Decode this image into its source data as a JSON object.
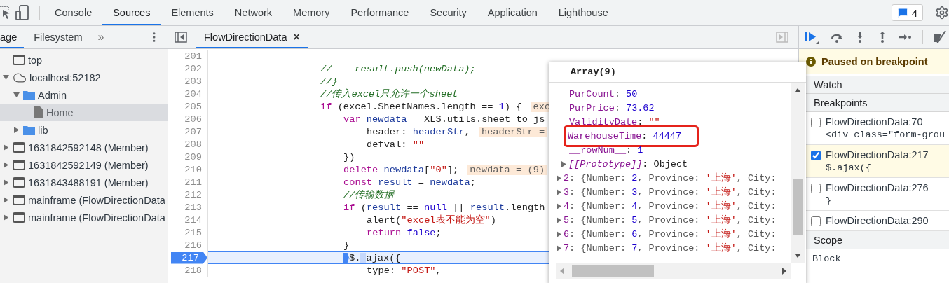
{
  "toolbar": {
    "tabs": [
      {
        "label": "Console",
        "selected": false
      },
      {
        "label": "Sources",
        "selected": true
      },
      {
        "label": "Elements",
        "selected": false
      },
      {
        "label": "Network",
        "selected": false
      },
      {
        "label": "Memory",
        "selected": false
      },
      {
        "label": "Performance",
        "selected": false
      },
      {
        "label": "Security",
        "selected": false
      },
      {
        "label": "Application",
        "selected": false
      },
      {
        "label": "Lighthouse",
        "selected": false
      }
    ],
    "issues": "4"
  },
  "navigator": {
    "tabs": [
      {
        "label": "age",
        "selected": true
      },
      {
        "label": "Filesystem",
        "selected": false
      }
    ],
    "more": "»",
    "tree": [
      {
        "label": "top",
        "kind": "frame",
        "selected": false
      },
      {
        "label": "localhost:52182",
        "kind": "cloud",
        "selected": false,
        "expanded": true,
        "children": [
          {
            "label": "Admin",
            "kind": "folder",
            "selected": false,
            "expanded": true,
            "children": [
              {
                "label": "Home",
                "kind": "file",
                "selected": true
              }
            ]
          },
          {
            "label": "lib",
            "kind": "folder",
            "selected": false,
            "expanded": false
          }
        ]
      },
      {
        "label": "1631842592148 (Member)",
        "kind": "frame",
        "selected": false,
        "expanded": false
      },
      {
        "label": "1631842592149 (Member)",
        "kind": "frame",
        "selected": false,
        "expanded": false
      },
      {
        "label": "1631843488191 (Member)",
        "kind": "frame",
        "selected": false,
        "expanded": false
      },
      {
        "label": "mainframe (FlowDirectionData",
        "kind": "frame",
        "selected": false,
        "expanded": false
      },
      {
        "label": "mainframe (FlowDirectionData",
        "kind": "frame",
        "selected": false,
        "expanded": false
      }
    ]
  },
  "editor": {
    "file_tabs": [
      {
        "label": "FlowDirectionData",
        "selected": true,
        "close": "×"
      }
    ],
    "lines": [
      {
        "number": "201",
        "paused": false
      },
      {
        "number": "202",
        "paused": false,
        "kind": "indent1",
        "tokens": [
          {
            "kind": "comment",
            "t": "//    result.push(newData);"
          }
        ]
      },
      {
        "number": "203",
        "paused": false,
        "kind": "indent1",
        "tokens": [
          {
            "kind": "comment",
            "t": "//}"
          }
        ]
      },
      {
        "number": "204",
        "paused": false,
        "kind": "indent1",
        "tokens": [
          {
            "kind": "comment",
            "t": "//传入excel只允许一个sheet"
          }
        ]
      },
      {
        "number": "205",
        "paused": false,
        "kind": "indent1",
        "tokens": [
          {
            "kind": "keyword",
            "t": "if"
          },
          {
            "kind": "plain",
            "t": " (excel.SheetNames.length == "
          },
          {
            "kind": "number",
            "t": "1"
          },
          {
            "kind": "plain",
            "t": ") {"
          },
          {
            "kind": "value",
            "t": "exc"
          }
        ]
      },
      {
        "number": "206",
        "paused": false,
        "kind": "indent2",
        "tokens": [
          {
            "kind": "keyword",
            "t": "var "
          },
          {
            "kind": "var",
            "t": "newdata"
          },
          {
            "kind": "plain",
            "t": " = XLS.utils.sheet_to_js"
          }
        ]
      },
      {
        "number": "207",
        "paused": false,
        "kind": "indent3",
        "tokens": [
          {
            "kind": "plain",
            "t": "header: "
          },
          {
            "kind": "var",
            "t": "headerStr"
          },
          {
            "kind": "plain",
            "t": ","
          },
          {
            "kind": "value",
            "t": "headerStr ="
          }
        ]
      },
      {
        "number": "208",
        "paused": false,
        "kind": "indent3",
        "tokens": [
          {
            "kind": "plain",
            "t": "defval: "
          },
          {
            "kind": "string",
            "t": "\"\""
          }
        ]
      },
      {
        "number": "209",
        "paused": false,
        "kind": "indent2",
        "tokens": [
          {
            "kind": "plain",
            "t": "})"
          }
        ]
      },
      {
        "number": "210",
        "paused": false,
        "kind": "indent2",
        "tokens": [
          {
            "kind": "keyword",
            "t": "delete "
          },
          {
            "kind": "var",
            "t": "newdata"
          },
          {
            "kind": "plain",
            "t": "["
          },
          {
            "kind": "string",
            "t": "\"0\""
          },
          {
            "kind": "plain",
            "t": "];"
          },
          {
            "kind": "value",
            "t": "newdata = (9)"
          }
        ]
      },
      {
        "number": "211",
        "paused": false,
        "kind": "indent2",
        "tokens": [
          {
            "kind": "keyword",
            "t": "const "
          },
          {
            "kind": "var",
            "t": "result"
          },
          {
            "kind": "plain",
            "t": " = "
          },
          {
            "kind": "var",
            "t": "newdata"
          },
          {
            "kind": "plain",
            "t": ";"
          }
        ]
      },
      {
        "number": "212",
        "paused": false,
        "kind": "indent2",
        "tokens": [
          {
            "kind": "comment",
            "t": "//传输数据"
          }
        ]
      },
      {
        "number": "213",
        "paused": false,
        "kind": "indent2",
        "tokens": [
          {
            "kind": "keyword",
            "t": "if"
          },
          {
            "kind": "plain",
            "t": " ("
          },
          {
            "kind": "var",
            "t": "result"
          },
          {
            "kind": "plain",
            "t": " == "
          },
          {
            "kind": "number",
            "t": "null"
          },
          {
            "kind": "plain",
            "t": " || "
          },
          {
            "kind": "var",
            "t": "result"
          },
          {
            "kind": "plain",
            "t": ".length"
          }
        ]
      },
      {
        "number": "214",
        "paused": false,
        "kind": "indent3",
        "tokens": [
          {
            "kind": "plain",
            "t": "alert("
          },
          {
            "kind": "string",
            "t": "\"excel表不能为空\""
          },
          {
            "kind": "plain",
            "t": ")"
          }
        ]
      },
      {
        "number": "215",
        "paused": false,
        "kind": "indent3",
        "tokens": [
          {
            "kind": "keyword",
            "t": "return "
          },
          {
            "kind": "number",
            "t": "false"
          },
          {
            "kind": "plain",
            "t": ";"
          }
        ]
      },
      {
        "number": "216",
        "paused": false,
        "kind": "indent2",
        "tokens": [
          {
            "kind": "plain",
            "t": "}"
          }
        ]
      },
      {
        "number": "217",
        "paused": true,
        "kind": "indent2",
        "tokens": [
          {
            "kind": "marker",
            "on": true
          },
          {
            "kind": "plain",
            "t": "$."
          },
          {
            "kind": "marker",
            "on": false
          },
          {
            "kind": "plain",
            "t": "ajax({"
          }
        ]
      },
      {
        "number": "218",
        "paused": false,
        "kind": "indent3",
        "tokens": [
          {
            "kind": "plain",
            "t": "type: "
          },
          {
            "kind": "string",
            "t": "\"POST\""
          },
          {
            "kind": "plain",
            "t": ","
          }
        ]
      }
    ]
  },
  "popup": {
    "title": "Array(9)",
    "rows": [
      {
        "kind": "prop",
        "key": "PurCount",
        "colon": ":",
        "value": {
          "kind": "number",
          "t": "50"
        },
        "highlighted": false
      },
      {
        "kind": "prop",
        "key": "PurPrice",
        "colon": ":",
        "value": {
          "kind": "number",
          "t": "73.62"
        },
        "highlighted": false
      },
      {
        "kind": "prop",
        "key": "ValidityDate",
        "colon": ":",
        "value": {
          "kind": "string",
          "t": "\"\""
        },
        "highlighted": false
      },
      {
        "kind": "prop",
        "key": "WarehouseTime",
        "colon": ":",
        "value": {
          "kind": "number",
          "t": "44447"
        },
        "highlighted": true
      },
      {
        "kind": "prop",
        "key": "__rowNum__",
        "colon": ":",
        "value": {
          "kind": "number",
          "t": "1"
        },
        "highlighted": false
      },
      {
        "kind": "proto",
        "key": "[[Prototype]]",
        "colon": ":",
        "value": {
          "kind": "plain",
          "t": "Object"
        },
        "expanded": false
      },
      {
        "kind": "entry",
        "key": "2",
        "colon": ":",
        "expanded": false,
        "preview": [
          {
            "kind": "plain",
            "t": "{Number: "
          },
          {
            "kind": "number",
            "t": "2"
          },
          {
            "kind": "plain",
            "t": ", Province: "
          },
          {
            "kind": "string",
            "t": "'上海'"
          },
          {
            "kind": "plain",
            "t": ", City:"
          }
        ]
      },
      {
        "kind": "entry",
        "key": "3",
        "colon": ":",
        "expanded": false,
        "preview": [
          {
            "kind": "plain",
            "t": "{Number: "
          },
          {
            "kind": "number",
            "t": "3"
          },
          {
            "kind": "plain",
            "t": ", Province: "
          },
          {
            "kind": "string",
            "t": "'上海'"
          },
          {
            "kind": "plain",
            "t": ", City:"
          }
        ]
      },
      {
        "kind": "entry",
        "key": "4",
        "colon": ":",
        "expanded": false,
        "preview": [
          {
            "kind": "plain",
            "t": "{Number: "
          },
          {
            "kind": "number",
            "t": "4"
          },
          {
            "kind": "plain",
            "t": ", Province: "
          },
          {
            "kind": "string",
            "t": "'上海'"
          },
          {
            "kind": "plain",
            "t": ", City:"
          }
        ]
      },
      {
        "kind": "entry",
        "key": "5",
        "colon": ":",
        "expanded": false,
        "preview": [
          {
            "kind": "plain",
            "t": "{Number: "
          },
          {
            "kind": "number",
            "t": "5"
          },
          {
            "kind": "plain",
            "t": ", Province: "
          },
          {
            "kind": "string",
            "t": "'上海'"
          },
          {
            "kind": "plain",
            "t": ", City:"
          }
        ]
      },
      {
        "kind": "entry",
        "key": "6",
        "colon": ":",
        "expanded": false,
        "preview": [
          {
            "kind": "plain",
            "t": "{Number: "
          },
          {
            "kind": "number",
            "t": "6"
          },
          {
            "kind": "plain",
            "t": ", Province: "
          },
          {
            "kind": "string",
            "t": "'上海'"
          },
          {
            "kind": "plain",
            "t": ", City:"
          }
        ]
      },
      {
        "kind": "entry",
        "key": "7",
        "colon": ":",
        "expanded": false,
        "preview": [
          {
            "kind": "plain",
            "t": "{Number: "
          },
          {
            "kind": "number",
            "t": "7"
          },
          {
            "kind": "plain",
            "t": ", Province: "
          },
          {
            "kind": "string",
            "t": "'上海'"
          },
          {
            "kind": "plain",
            "t": ", City:"
          }
        ]
      }
    ]
  },
  "debugger": {
    "banner": "Paused on breakpoint",
    "sections": [
      {
        "kind": "plain",
        "title": "Watch"
      },
      {
        "kind": "breakpoints",
        "title": "Breakpoints",
        "breakpoints": [
          {
            "label": "FlowDirectionData:70",
            "code": "<div class=\"form-grou",
            "checked": false,
            "hit": false
          },
          {
            "label": "FlowDirectionData:217",
            "code": "$.ajax({",
            "checked": true,
            "hit": true
          },
          {
            "label": "FlowDirectionData:276",
            "code": "}",
            "checked": false,
            "hit": false
          },
          {
            "label": "FlowDirectionData:290",
            "checked": false,
            "hit": false
          }
        ]
      },
      {
        "kind": "scope",
        "title": "Scope",
        "scopes": [
          "Block"
        ]
      }
    ]
  }
}
